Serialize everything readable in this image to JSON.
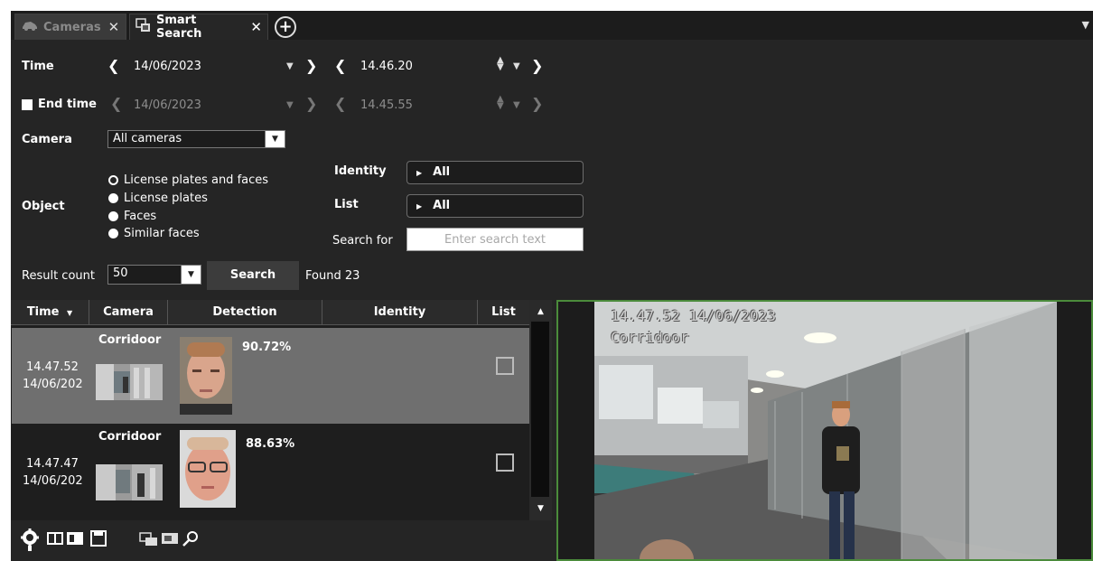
{
  "tabs": [
    {
      "label": "Cameras",
      "close": "✕"
    },
    {
      "label": "Smart Search",
      "close": "✕"
    }
  ],
  "add_tab_symbol": "+",
  "form": {
    "time_label": "Time",
    "time_date": "14/06/2023",
    "time_clock": "14.46.20",
    "end_time_label": "End time",
    "end_time_checked": false,
    "end_date": "14/06/2023",
    "end_clock": "14.45.55",
    "camera_label": "Camera",
    "camera_value": "All cameras",
    "object_label": "Object",
    "object_options": [
      {
        "label": "License plates and faces",
        "selected": true
      },
      {
        "label": "License plates",
        "selected": false
      },
      {
        "label": "Faces",
        "selected": false
      },
      {
        "label": "Similar faces",
        "selected": false
      }
    ],
    "identity_label": "Identity",
    "identity_value": "All",
    "list_label": "List",
    "list_value": "All",
    "search_for_label": "Search for",
    "search_placeholder": "Enter search text",
    "result_count_label": "Result count",
    "result_count_value": "50",
    "search_button": "Search",
    "found_text": "Found 23"
  },
  "table": {
    "headers": [
      "Time",
      "Camera",
      "Detection",
      "Identity",
      "List"
    ],
    "rows": [
      {
        "time": "14.47.52",
        "date": "14/06/202",
        "camera": "Corridoor",
        "score": "90.72%",
        "selected": true
      },
      {
        "time": "14.47.47",
        "date": "14/06/202",
        "camera": "Corridoor",
        "score": "88.63%",
        "selected": false
      }
    ]
  },
  "video": {
    "timestamp": "14.47.52  14/06/2023",
    "camera": "Corridoor"
  },
  "colors": {
    "background": "#252525",
    "selected_row": "#6f6f6f",
    "video_border": "#4b8b3b"
  },
  "icons": [
    "car-icon",
    "smart-search-icon",
    "add-tab-icon",
    "menu-dropdown-icon",
    "gear-icon",
    "single-view-icon",
    "split-view-icon",
    "save-icon",
    "cameras-icon",
    "display-icon",
    "search-icon"
  ]
}
